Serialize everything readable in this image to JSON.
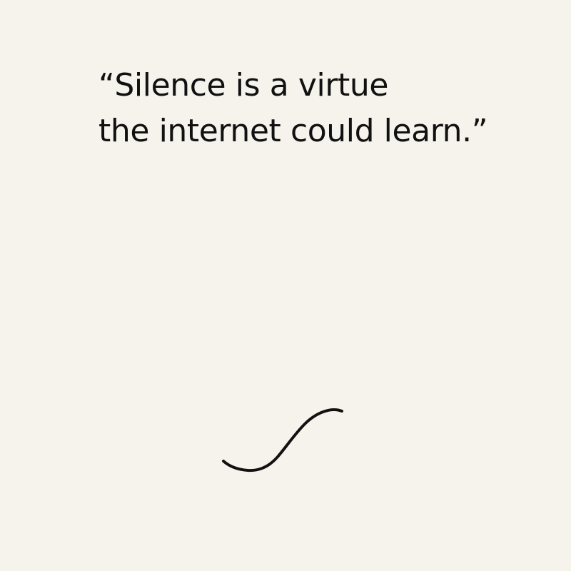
{
  "quote": {
    "line1": "“Silence is a virtue",
    "line2": "the internet could learn.”"
  },
  "decoration": {
    "icon": "swash-curve-icon"
  },
  "colors": {
    "background": "#f6f2ec",
    "text": "#111111",
    "stroke": "#111111"
  }
}
